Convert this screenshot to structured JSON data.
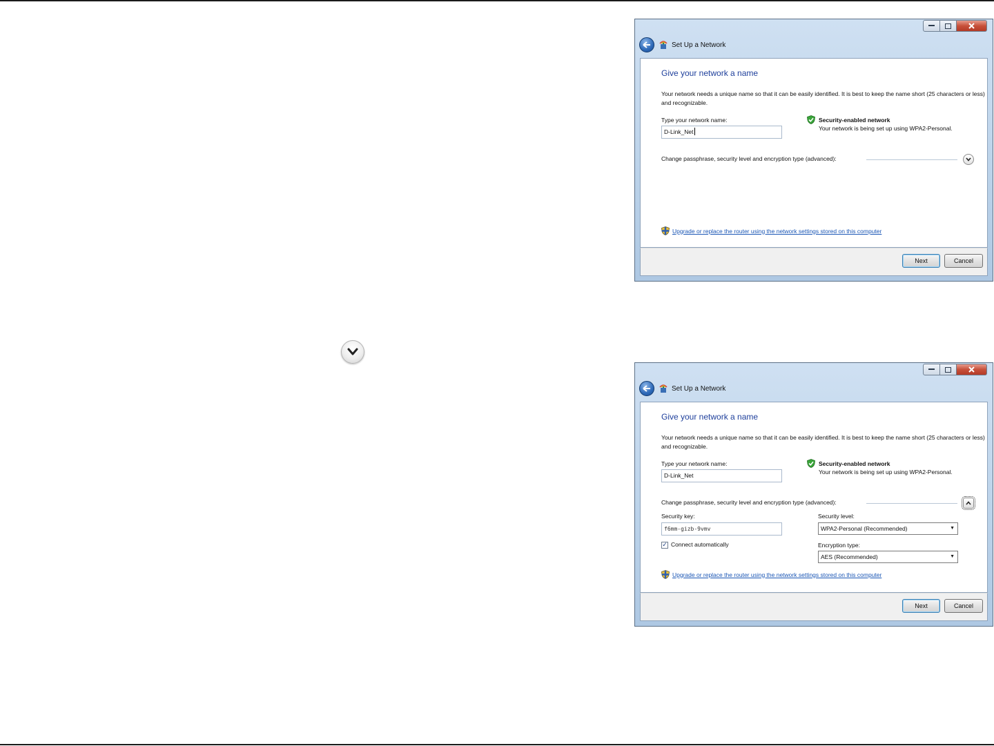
{
  "page": {
    "expand_icon": "chevron-down-circle-icon"
  },
  "dialog_collapsed": {
    "window_title": "Set Up a Network",
    "heading": "Give your network a name",
    "description": "Your network needs a unique name so that it can be easily identified. It is best to keep the name short (25 characters or less) and recognizable.",
    "network_name_label": "Type your network name:",
    "network_name_value": "D-Link_Net",
    "security_title": "Security-enabled network",
    "security_desc": "Your network is being set up using WPA2-Personal.",
    "advanced_label": "Change passphrase, security level and encryption type (advanced):",
    "upgrade_link": "Upgrade or replace the router using the network settings stored on this computer",
    "next_label": "Next",
    "cancel_label": "Cancel"
  },
  "dialog_expanded": {
    "window_title": "Set Up a Network",
    "heading": "Give your network a name",
    "description": "Your network needs a unique name so that it can be easily identified. It is best to keep the name short (25 characters or less) and recognizable.",
    "network_name_label": "Type your network name:",
    "network_name_value": "D-Link_Net",
    "security_title": "Security-enabled network",
    "security_desc": "Your network is being set up using WPA2-Personal.",
    "advanced_label": "Change passphrase, security level and encryption type (advanced):",
    "security_key_label": "Security key:",
    "security_key_value": "f6mm-gizb-9vmv",
    "security_level_label": "Security level:",
    "security_level_value": "WPA2-Personal (Recommended)",
    "connect_auto_label": "Connect automatically",
    "connect_auto_checked": true,
    "encryption_label": "Encryption type:",
    "encryption_value": "AES (Recommended)",
    "upgrade_link": "Upgrade or replace the router using the network settings stored on this computer",
    "next_label": "Next",
    "cancel_label": "Cancel"
  },
  "colors": {
    "heading_blue": "#1e3f9b",
    "link_blue": "#1a56b5",
    "close_red": "#c7503a",
    "title_glass": "#bcd3ea"
  }
}
